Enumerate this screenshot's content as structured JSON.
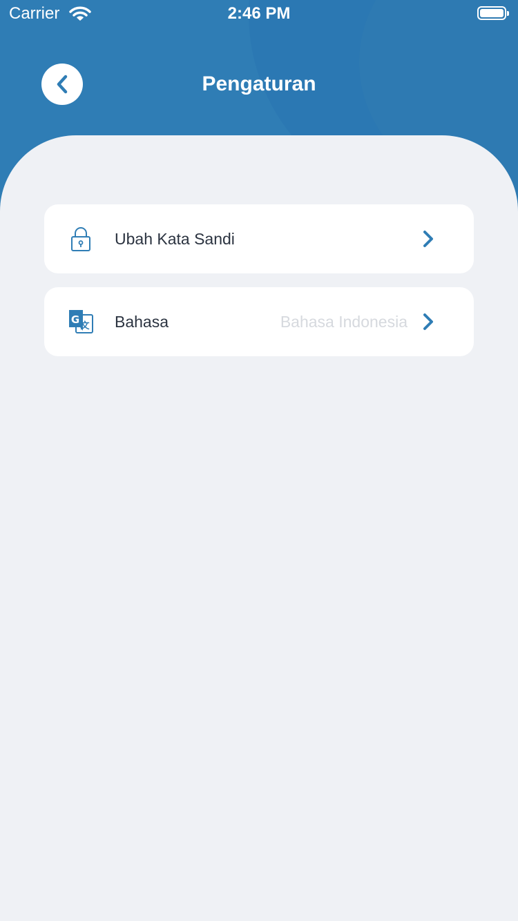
{
  "status_bar": {
    "carrier": "Carrier",
    "time": "2:46 PM"
  },
  "header": {
    "title": "Pengaturan",
    "back_icon": "chevron-left-icon"
  },
  "settings": {
    "items": [
      {
        "label": "Ubah Kata Sandi",
        "icon": "lock-icon",
        "value": ""
      },
      {
        "label": "Bahasa",
        "icon": "translate-icon",
        "value": "Bahasa Indonesia"
      }
    ]
  },
  "colors": {
    "primary": "#2f7db5",
    "background": "#eff1f5",
    "text": "#2b3340",
    "muted": "#d6d9de"
  }
}
